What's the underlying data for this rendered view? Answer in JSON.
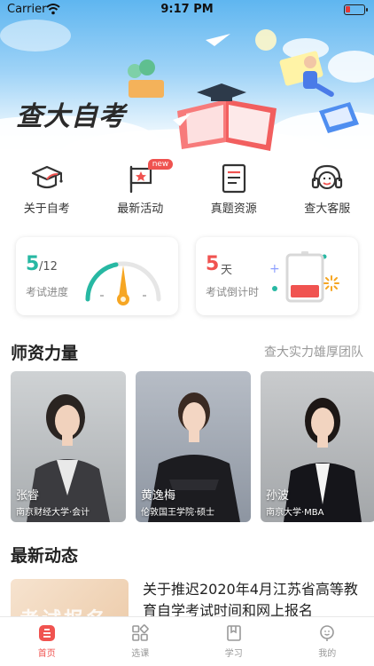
{
  "status_bar": {
    "carrier": "Carrier",
    "time": "9:17 PM"
  },
  "banner": {
    "title": "查大自考"
  },
  "quick_menu": [
    {
      "label": "关于自考",
      "icon": "graduation-cap-icon"
    },
    {
      "label": "最新活动",
      "icon": "flag-icon",
      "badge": "new"
    },
    {
      "label": "真题资源",
      "icon": "document-icon"
    },
    {
      "label": "查大客服",
      "icon": "headset-icon"
    }
  ],
  "exam_progress": {
    "value": "5",
    "total": "/12",
    "label": "考试进度"
  },
  "countdown": {
    "value": "5",
    "unit": "天",
    "label": "考试倒计时"
  },
  "teachers_section": {
    "title": "师资力量",
    "subtitle": "查大实力雄厚团队"
  },
  "teachers": [
    {
      "name": "张睿",
      "desc": "南京财经大学·会计"
    },
    {
      "name": "黄逸梅",
      "desc": "伦敦国王学院·硕士"
    },
    {
      "name": "孙波",
      "desc": "南京大学·MBA"
    }
  ],
  "news_section": {
    "title": "最新动态"
  },
  "news": [
    {
      "title": "关于推迟2020年4月江苏省高等教育自学考试时间和网上报名",
      "thumb_text": "考试报名"
    }
  ],
  "tabs": [
    {
      "label": "首页",
      "icon": "home-icon",
      "active": true
    },
    {
      "label": "选课",
      "icon": "grid-icon",
      "active": false
    },
    {
      "label": "学习",
      "icon": "book-icon",
      "active": false
    },
    {
      "label": "我的",
      "icon": "profile-icon",
      "active": false
    }
  ],
  "colors": {
    "accent": "#f05350",
    "teal": "#27b8a3",
    "sky": "#5fb6f0"
  }
}
